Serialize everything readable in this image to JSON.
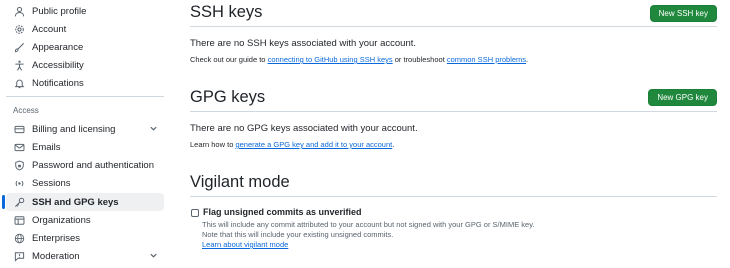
{
  "sidebar": {
    "items_top": [
      {
        "label": "Public profile",
        "icon": "person-icon"
      },
      {
        "label": "Account",
        "icon": "gear-icon"
      },
      {
        "label": "Appearance",
        "icon": "paintbrush-icon"
      },
      {
        "label": "Accessibility",
        "icon": "accessibility-icon"
      },
      {
        "label": "Notifications",
        "icon": "bell-icon"
      }
    ],
    "section_access": "Access",
    "items_access": [
      {
        "label": "Billing and licensing",
        "icon": "credit-card-icon"
      },
      {
        "label": "Emails",
        "icon": "mail-icon"
      },
      {
        "label": "Password and authentication",
        "icon": "shield-lock-icon"
      },
      {
        "label": "Sessions",
        "icon": "broadcast-icon"
      },
      {
        "label": "SSH and GPG keys",
        "icon": "key-icon"
      },
      {
        "label": "Organizations",
        "icon": "table-icon"
      },
      {
        "label": "Enterprises",
        "icon": "globe-icon"
      },
      {
        "label": "Moderation",
        "icon": "report-icon"
      }
    ],
    "active_item": "SSH and GPG keys"
  },
  "ssh": {
    "title": "SSH keys",
    "button": "New SSH key",
    "empty": "There are no SSH keys associated with your account.",
    "guide_prefix": "Check out our guide to ",
    "guide_link1": "connecting to GitHub using SSH keys",
    "guide_mid": " or troubleshoot ",
    "guide_link2": "common SSH problems",
    "guide_suffix": "."
  },
  "gpg": {
    "title": "GPG keys",
    "button": "New GPG key",
    "empty": "There are no GPG keys associated with your account.",
    "guide_prefix": "Learn how to ",
    "guide_link": "generate a GPG key and add it to your account",
    "guide_suffix": "."
  },
  "vigilant": {
    "title": "Vigilant mode",
    "checkbox_label": "Flag unsigned commits as unverified",
    "checkbox_checked": false,
    "note1": "This will include any commit attributed to your account but not signed with your GPG or S/MIME key.",
    "note2": "Note that this will include your existing unsigned commits.",
    "learn_link": "Learn about vigilant mode"
  },
  "colors": {
    "accent": "#0969da",
    "primary_button": "#1f883d"
  }
}
